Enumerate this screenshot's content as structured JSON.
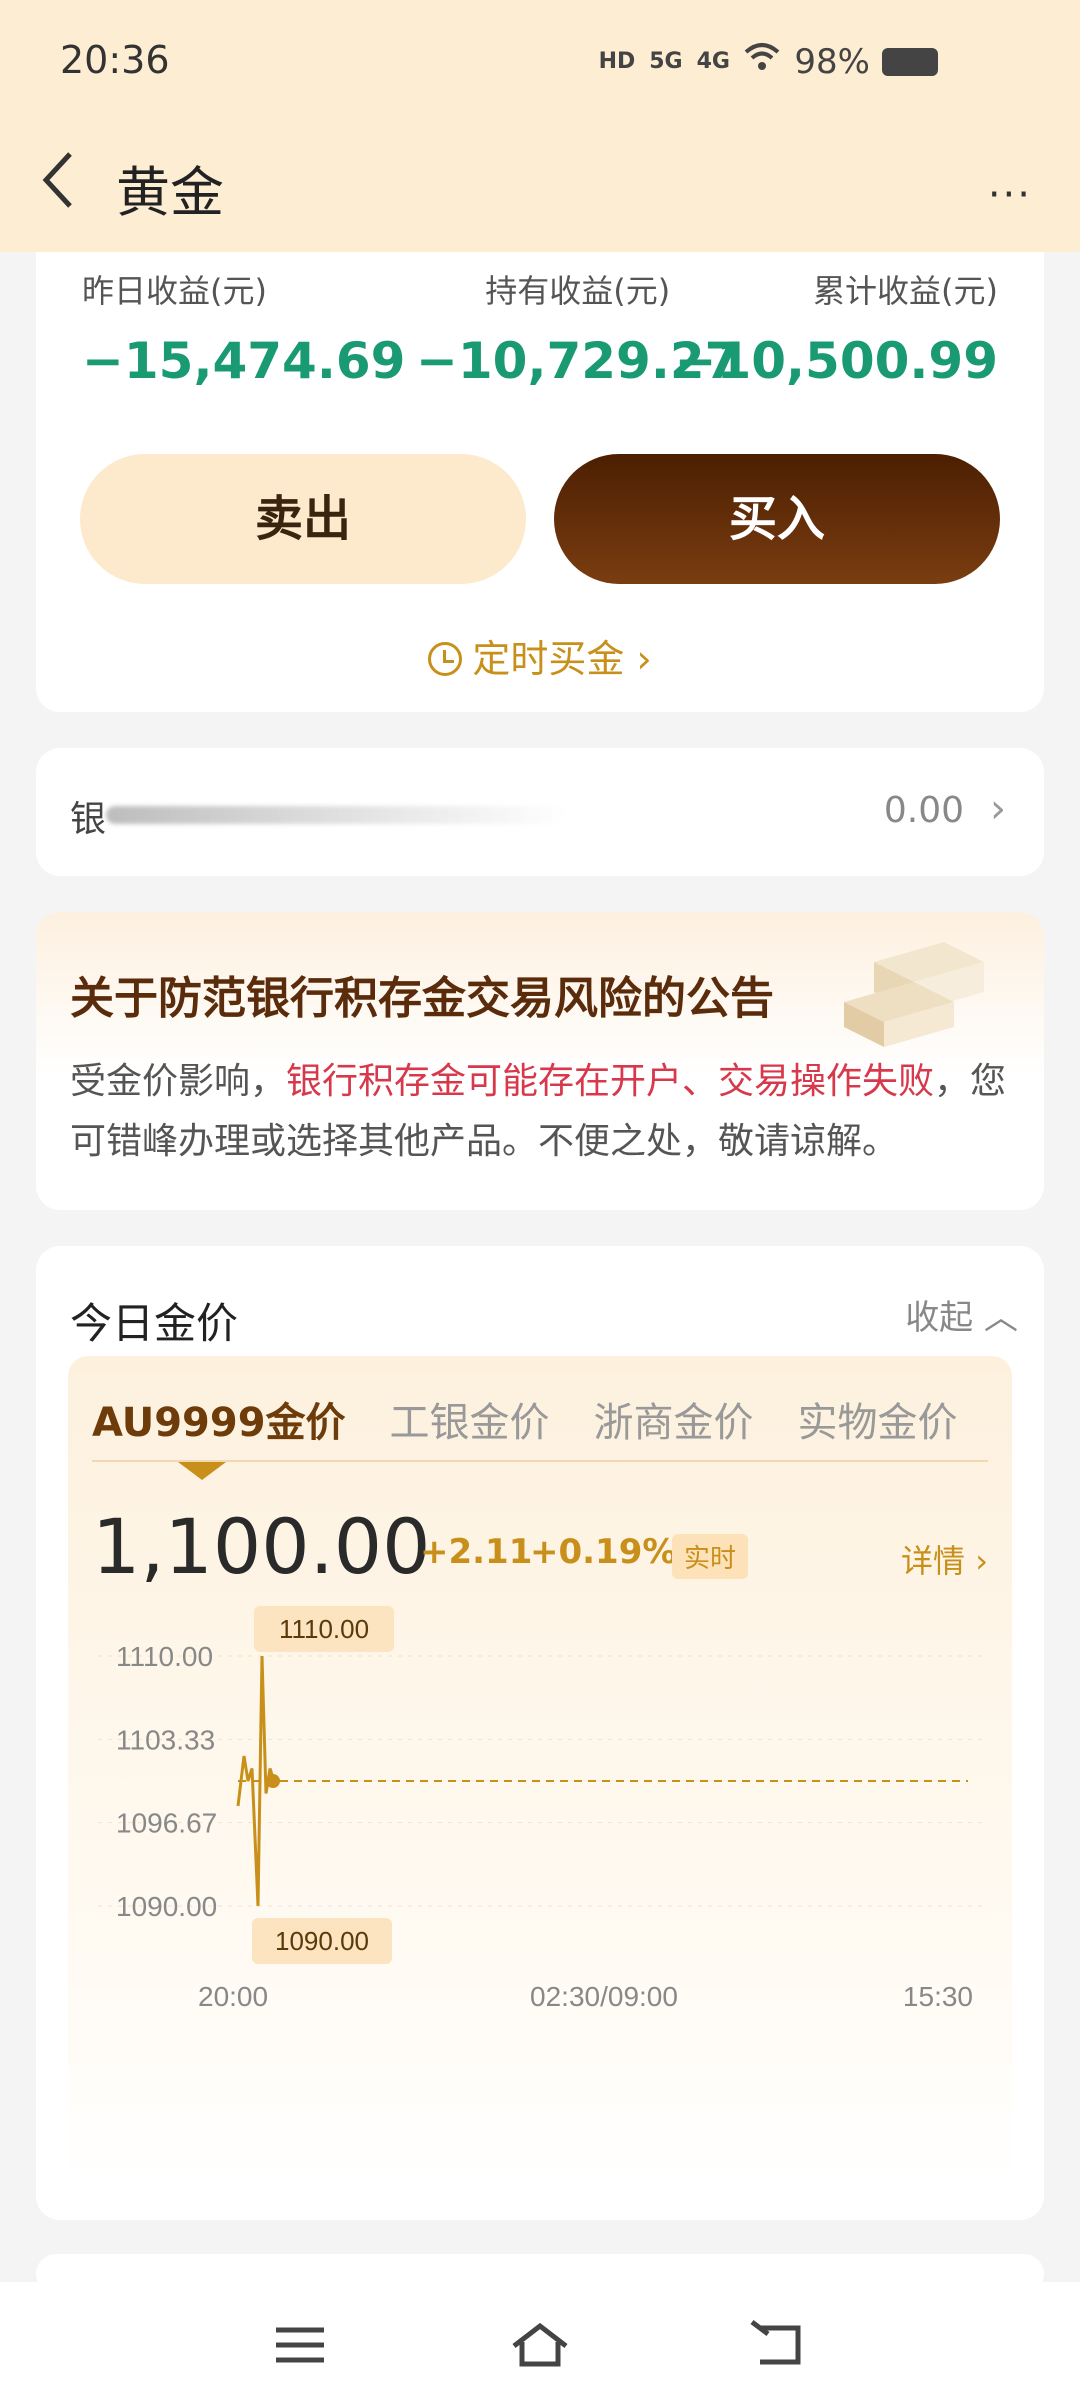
{
  "status": {
    "time": "20:36",
    "battery": "98%",
    "signal1": "5G",
    "signal2": "4G",
    "hd": "HD"
  },
  "header": {
    "title": "黄金",
    "more": "···"
  },
  "summary": {
    "yesterday_label": "昨日收益(元)",
    "yesterday_value": "−15,474.69",
    "holding_label": "持有收益(元)",
    "holding_value": "−10,729.27",
    "total_label": "累计收益(元)",
    "total_value": "−10,500.99",
    "sell_label": "卖出",
    "buy_label": "买入",
    "timer_label": "定时买金",
    "value_color": "#1a9a73"
  },
  "bank": {
    "name": "银",
    "value": "0.00"
  },
  "notice": {
    "title": "关于防范银行积存金交易风险的公告",
    "body_prefix": "受金价影响，",
    "body_highlight": "银行积存金可能存在开户、交易操作失败",
    "body_suffix": "，您可错峰办理或选择其他产品。不便之处，敬请谅解。"
  },
  "price": {
    "heading": "今日金价",
    "collapse": "收起",
    "tabs": [
      "AU9999金价",
      "工银金价",
      "浙商金价",
      "实物金价"
    ],
    "active_tab": 0,
    "current": "1,100.00",
    "change": "+2.11",
    "change_pct": "+0.19%",
    "live_badge": "实时",
    "detail": "详情",
    "accent": "#c8901a"
  },
  "chart_data": {
    "type": "line",
    "y_ticks": [
      "1110.00",
      "1103.33",
      "1096.67",
      "1090.00"
    ],
    "ylim": [
      1090,
      1110
    ],
    "x_ticks": [
      "20:00",
      "02:30/09:00",
      "15:30"
    ],
    "max_label": "1110.00",
    "min_label": "1090.00",
    "reference": 1100,
    "series": [
      {
        "values": [
          1098,
          1102,
          1100,
          1101,
          1090,
          1110,
          1099,
          1101,
          1100,
          1100
        ]
      }
    ]
  },
  "navbar": {
    "menu": "menu",
    "home": "home",
    "back": "back"
  }
}
